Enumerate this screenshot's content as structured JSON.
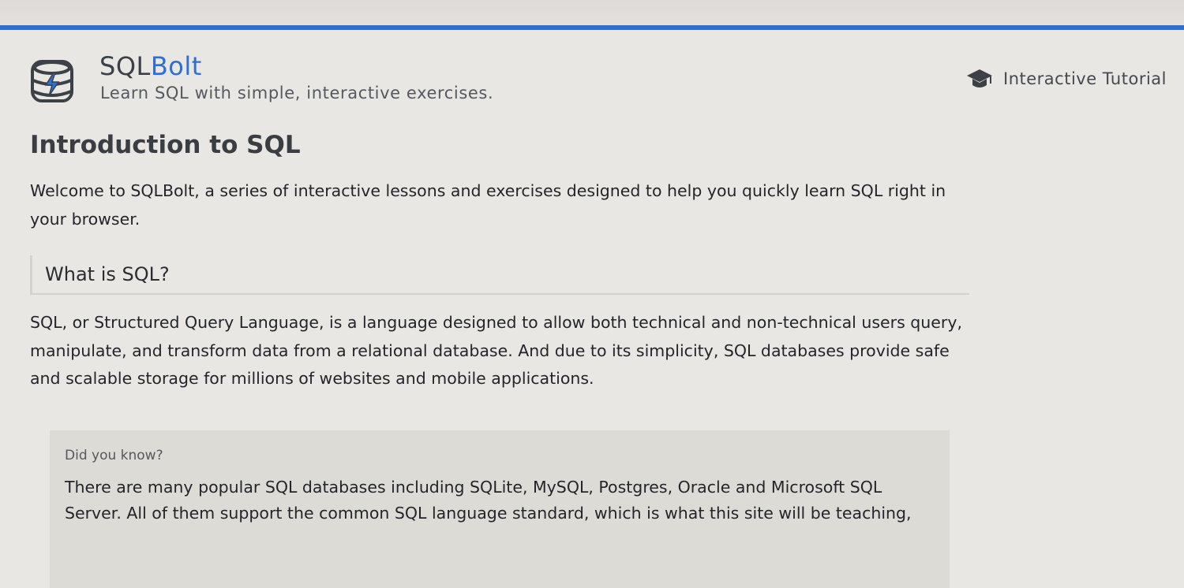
{
  "header": {
    "brand_sql": "SQL",
    "brand_bolt": "Bolt",
    "tagline": "Learn SQL with simple, interactive exercises.",
    "nav_tutorial_label": "Interactive Tutorial",
    "nav_icon": "graduation-cap-icon",
    "logo_icon": "database-bolt-icon"
  },
  "colors": {
    "accent": "#2e6fd2",
    "background": "#e8e7e4",
    "callout_bg": "#dcdbd6"
  },
  "main": {
    "title": "Introduction to SQL",
    "intro": "Welcome to SQLBolt, a series of interactive lessons and exercises designed to help you quickly learn SQL right in your browser.",
    "section_heading": "What is SQL?",
    "section_body": "SQL, or Structured Query Language, is a language designed to allow both technical and non-technical users query, manipulate, and transform data from a relational database. And due to its simplicity, SQL databases provide safe and scalable storage for millions of websites and mobile applications.",
    "callout": {
      "title": "Did you know?",
      "body": "There are many popular SQL databases including SQLite, MySQL, Postgres, Oracle and Microsoft SQL Server. All of them support the common SQL language standard, which is what this site will be teaching,"
    }
  }
}
